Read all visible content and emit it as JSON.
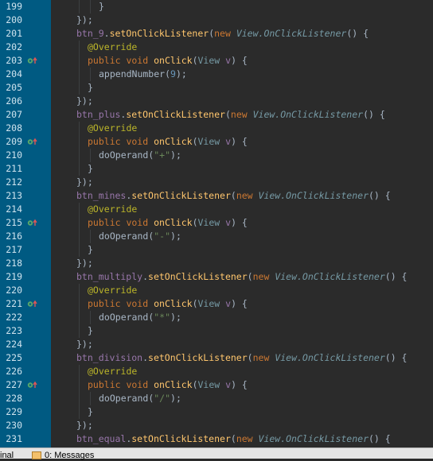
{
  "editor": {
    "lines": [
      {
        "num": "199",
        "icon": "",
        "indent": 3,
        "tokens": [
          {
            "t": "}",
            "c": "punc"
          }
        ]
      },
      {
        "num": "200",
        "icon": "",
        "indent": 1,
        "tokens": [
          {
            "t": "});",
            "c": "punc"
          }
        ]
      },
      {
        "num": "201",
        "icon": "",
        "indent": 1,
        "tokens": [
          {
            "t": "btn_9",
            "c": "fld"
          },
          {
            "t": ".",
            "c": "punc"
          },
          {
            "t": "setOnClickListener",
            "c": "meth"
          },
          {
            "t": "(",
            "c": "punc"
          },
          {
            "t": "new ",
            "c": "kw"
          },
          {
            "t": "View.OnClickListener",
            "c": "type"
          },
          {
            "t": "() {",
            "c": "punc"
          }
        ]
      },
      {
        "num": "202",
        "icon": "",
        "indent": 2,
        "tokens": [
          {
            "t": "@Override",
            "c": "ann"
          }
        ]
      },
      {
        "num": "203",
        "icon": "override-implements-icon",
        "indent": 2,
        "tokens": [
          {
            "t": "public void ",
            "c": "kw"
          },
          {
            "t": "onClick",
            "c": "meth"
          },
          {
            "t": "(",
            "c": "punc"
          },
          {
            "t": "View ",
            "c": "type-plain"
          },
          {
            "t": "v",
            "c": "fld"
          },
          {
            "t": ") {",
            "c": "punc"
          }
        ]
      },
      {
        "num": "204",
        "icon": "",
        "indent": 3,
        "tokens": [
          {
            "t": "appendNumber",
            "c": "call"
          },
          {
            "t": "(",
            "c": "punc"
          },
          {
            "t": "9",
            "c": "num"
          },
          {
            "t": ");",
            "c": "punc"
          }
        ]
      },
      {
        "num": "205",
        "icon": "",
        "indent": 2,
        "tokens": [
          {
            "t": "}",
            "c": "punc"
          }
        ]
      },
      {
        "num": "206",
        "icon": "",
        "indent": 1,
        "tokens": [
          {
            "t": "});",
            "c": "punc"
          }
        ]
      },
      {
        "num": "207",
        "icon": "",
        "indent": 1,
        "tokens": [
          {
            "t": "btn_plus",
            "c": "fld"
          },
          {
            "t": ".",
            "c": "punc"
          },
          {
            "t": "setOnClickListener",
            "c": "meth"
          },
          {
            "t": "(",
            "c": "punc"
          },
          {
            "t": "new ",
            "c": "kw"
          },
          {
            "t": "View.OnClickListener",
            "c": "type"
          },
          {
            "t": "() {",
            "c": "punc"
          }
        ]
      },
      {
        "num": "208",
        "icon": "",
        "indent": 2,
        "tokens": [
          {
            "t": "@Override",
            "c": "ann"
          }
        ]
      },
      {
        "num": "209",
        "icon": "override-implements-icon",
        "indent": 2,
        "tokens": [
          {
            "t": "public void ",
            "c": "kw"
          },
          {
            "t": "onClick",
            "c": "meth"
          },
          {
            "t": "(",
            "c": "punc"
          },
          {
            "t": "View ",
            "c": "type-plain"
          },
          {
            "t": "v",
            "c": "fld"
          },
          {
            "t": ") {",
            "c": "punc"
          }
        ]
      },
      {
        "num": "210",
        "icon": "",
        "indent": 3,
        "tokens": [
          {
            "t": "doOperand",
            "c": "call"
          },
          {
            "t": "(",
            "c": "punc"
          },
          {
            "t": "\"+\"",
            "c": "str"
          },
          {
            "t": ");",
            "c": "punc"
          }
        ]
      },
      {
        "num": "211",
        "icon": "",
        "indent": 2,
        "tokens": [
          {
            "t": "}",
            "c": "punc"
          }
        ]
      },
      {
        "num": "212",
        "icon": "",
        "indent": 1,
        "tokens": [
          {
            "t": "});",
            "c": "punc"
          }
        ]
      },
      {
        "num": "213",
        "icon": "",
        "indent": 1,
        "tokens": [
          {
            "t": "btn_mines",
            "c": "fld"
          },
          {
            "t": ".",
            "c": "punc"
          },
          {
            "t": "setOnClickListener",
            "c": "meth"
          },
          {
            "t": "(",
            "c": "punc"
          },
          {
            "t": "new ",
            "c": "kw"
          },
          {
            "t": "View.OnClickListener",
            "c": "type"
          },
          {
            "t": "() {",
            "c": "punc"
          }
        ]
      },
      {
        "num": "214",
        "icon": "",
        "indent": 2,
        "tokens": [
          {
            "t": "@Override",
            "c": "ann"
          }
        ]
      },
      {
        "num": "215",
        "icon": "override-implements-icon",
        "indent": 2,
        "tokens": [
          {
            "t": "public void ",
            "c": "kw"
          },
          {
            "t": "onClick",
            "c": "meth"
          },
          {
            "t": "(",
            "c": "punc"
          },
          {
            "t": "View ",
            "c": "type-plain"
          },
          {
            "t": "v",
            "c": "fld"
          },
          {
            "t": ") {",
            "c": "punc"
          }
        ]
      },
      {
        "num": "216",
        "icon": "",
        "indent": 3,
        "tokens": [
          {
            "t": "doOperand",
            "c": "call"
          },
          {
            "t": "(",
            "c": "punc"
          },
          {
            "t": "\"-\"",
            "c": "str"
          },
          {
            "t": ");",
            "c": "punc"
          }
        ]
      },
      {
        "num": "217",
        "icon": "",
        "indent": 2,
        "tokens": [
          {
            "t": "}",
            "c": "punc"
          }
        ]
      },
      {
        "num": "218",
        "icon": "",
        "indent": 1,
        "tokens": [
          {
            "t": "});",
            "c": "punc"
          }
        ]
      },
      {
        "num": "219",
        "icon": "",
        "indent": 1,
        "tokens": [
          {
            "t": "btn_multiply",
            "c": "fld"
          },
          {
            "t": ".",
            "c": "punc"
          },
          {
            "t": "setOnClickListener",
            "c": "meth"
          },
          {
            "t": "(",
            "c": "punc"
          },
          {
            "t": "new ",
            "c": "kw"
          },
          {
            "t": "View.OnClickListener",
            "c": "type"
          },
          {
            "t": "() {",
            "c": "punc"
          }
        ]
      },
      {
        "num": "220",
        "icon": "",
        "indent": 2,
        "tokens": [
          {
            "t": "@Override",
            "c": "ann"
          }
        ]
      },
      {
        "num": "221",
        "icon": "override-implements-icon",
        "indent": 2,
        "tokens": [
          {
            "t": "public void ",
            "c": "kw"
          },
          {
            "t": "onClick",
            "c": "meth"
          },
          {
            "t": "(",
            "c": "punc"
          },
          {
            "t": "View ",
            "c": "type-plain"
          },
          {
            "t": "v",
            "c": "fld"
          },
          {
            "t": ") {",
            "c": "punc"
          }
        ]
      },
      {
        "num": "222",
        "icon": "",
        "indent": 3,
        "tokens": [
          {
            "t": "doOperand",
            "c": "call"
          },
          {
            "t": "(",
            "c": "punc"
          },
          {
            "t": "\"*\"",
            "c": "str"
          },
          {
            "t": ");",
            "c": "punc"
          }
        ]
      },
      {
        "num": "223",
        "icon": "",
        "indent": 2,
        "tokens": [
          {
            "t": "}",
            "c": "punc"
          }
        ]
      },
      {
        "num": "224",
        "icon": "",
        "indent": 1,
        "tokens": [
          {
            "t": "});",
            "c": "punc"
          }
        ]
      },
      {
        "num": "225",
        "icon": "",
        "indent": 1,
        "tokens": [
          {
            "t": "btn_division",
            "c": "fld"
          },
          {
            "t": ".",
            "c": "punc"
          },
          {
            "t": "setOnClickListener",
            "c": "meth"
          },
          {
            "t": "(",
            "c": "punc"
          },
          {
            "t": "new ",
            "c": "kw"
          },
          {
            "t": "View.OnClickListener",
            "c": "type"
          },
          {
            "t": "() {",
            "c": "punc"
          }
        ]
      },
      {
        "num": "226",
        "icon": "",
        "indent": 2,
        "tokens": [
          {
            "t": "@Override",
            "c": "ann"
          }
        ]
      },
      {
        "num": "227",
        "icon": "override-implements-icon",
        "indent": 2,
        "tokens": [
          {
            "t": "public void ",
            "c": "kw"
          },
          {
            "t": "onClick",
            "c": "meth"
          },
          {
            "t": "(",
            "c": "punc"
          },
          {
            "t": "View ",
            "c": "type-plain"
          },
          {
            "t": "v",
            "c": "fld"
          },
          {
            "t": ") {",
            "c": "punc"
          }
        ]
      },
      {
        "num": "228",
        "icon": "",
        "indent": 3,
        "tokens": [
          {
            "t": "doOperand",
            "c": "call"
          },
          {
            "t": "(",
            "c": "punc"
          },
          {
            "t": "\"/\"",
            "c": "str"
          },
          {
            "t": ");",
            "c": "punc"
          }
        ]
      },
      {
        "num": "229",
        "icon": "",
        "indent": 2,
        "tokens": [
          {
            "t": "}",
            "c": "punc"
          }
        ]
      },
      {
        "num": "230",
        "icon": "",
        "indent": 1,
        "tokens": [
          {
            "t": "});",
            "c": "punc"
          }
        ]
      },
      {
        "num": "231",
        "icon": "",
        "indent": 1,
        "tokens": [
          {
            "t": "btn_equal",
            "c": "fld"
          },
          {
            "t": ".",
            "c": "punc"
          },
          {
            "t": "setOnClickListener",
            "c": "meth"
          },
          {
            "t": "(",
            "c": "punc"
          },
          {
            "t": "new ",
            "c": "kw"
          },
          {
            "t": "View.OnClickListener",
            "c": "type"
          },
          {
            "t": "() {",
            "c": "punc"
          }
        ]
      }
    ]
  },
  "bottom_bar": {
    "terminal_label": "inal",
    "messages_label": "0: Messages",
    "messages_icon": "messages-icon"
  },
  "colors": {
    "gutter": "#005a82",
    "editor_bg": "#2b2b2b",
    "keyword": "#cc7832",
    "method": "#ffc66d",
    "field": "#9876aa",
    "annotation": "#bbb529",
    "string": "#6a8759",
    "number": "#6897bb",
    "type": "#769aa5"
  }
}
